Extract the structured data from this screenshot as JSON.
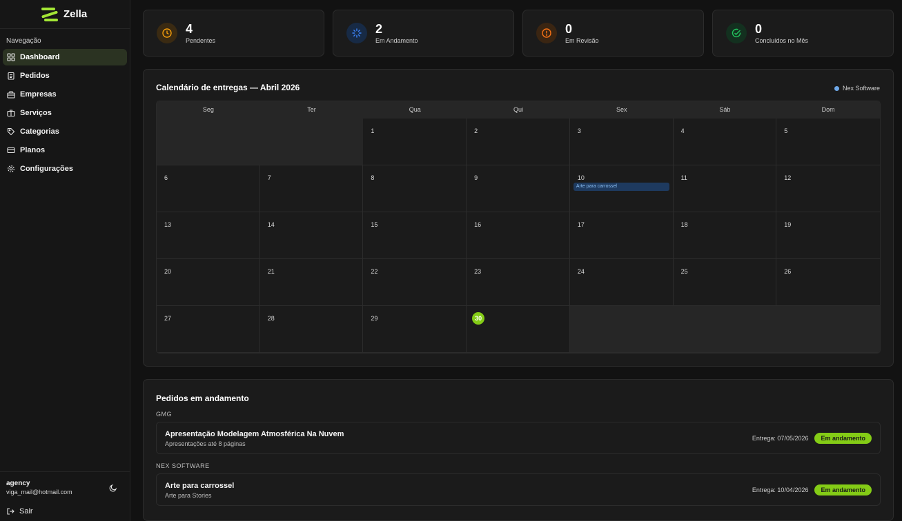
{
  "brand": {
    "name": "Zella"
  },
  "sidebar": {
    "section_label": "Navegação",
    "items": [
      {
        "label": "Dashboard",
        "icon": "dashboard-icon",
        "active": true
      },
      {
        "label": "Pedidos",
        "icon": "clipboard-icon"
      },
      {
        "label": "Empresas",
        "icon": "building-icon"
      },
      {
        "label": "Serviços",
        "icon": "briefcase-icon"
      },
      {
        "label": "Categorias",
        "icon": "tag-icon"
      },
      {
        "label": "Planos",
        "icon": "credit-card-icon"
      },
      {
        "label": "Configurações",
        "icon": "gear-icon"
      }
    ],
    "user": {
      "name": "agency",
      "email": "viga_mail@hotmail.com"
    },
    "logout_label": "Sair"
  },
  "stats": [
    {
      "value": "4",
      "label": "Pendentes",
      "icon": "clock-icon",
      "color": "#f59e0b"
    },
    {
      "value": "2",
      "label": "Em Andamento",
      "icon": "loader-icon",
      "color": "#3b82f6"
    },
    {
      "value": "0",
      "label": "Em Revisão",
      "icon": "alert-circle-icon",
      "color": "#f97316"
    },
    {
      "value": "0",
      "label": "Concluídos no Mês",
      "icon": "check-circle-icon",
      "color": "#22c55e"
    }
  ],
  "calendar": {
    "title": "Calendário de entregas — Abril 2026",
    "legend": "Nex Software",
    "weekdays": [
      "Seg",
      "Ter",
      "Qua",
      "Qui",
      "Sex",
      "Sáb",
      "Dom"
    ],
    "today": "30",
    "event": {
      "day": "10",
      "label": "Arte para carrossel"
    }
  },
  "orders": {
    "title": "Pedidos em andamento",
    "groups": [
      {
        "name": "GMG",
        "items": [
          {
            "title": "Apresentação Modelagem Atmosférica Na Nuvem",
            "subtitle": "Apresentações até 8 páginas",
            "date": "Entrega: 07/05/2026",
            "status": "Em andamento"
          }
        ]
      },
      {
        "name": "NEX SOFTWARE",
        "items": [
          {
            "title": "Arte para carrossel",
            "subtitle": "Arte para Stories",
            "date": "Entrega: 10/04/2026",
            "status": "Em andamento"
          }
        ]
      }
    ]
  },
  "colors": {
    "accent": "#84cc16",
    "event_bg": "#1e3a5f",
    "background": "#121212"
  }
}
